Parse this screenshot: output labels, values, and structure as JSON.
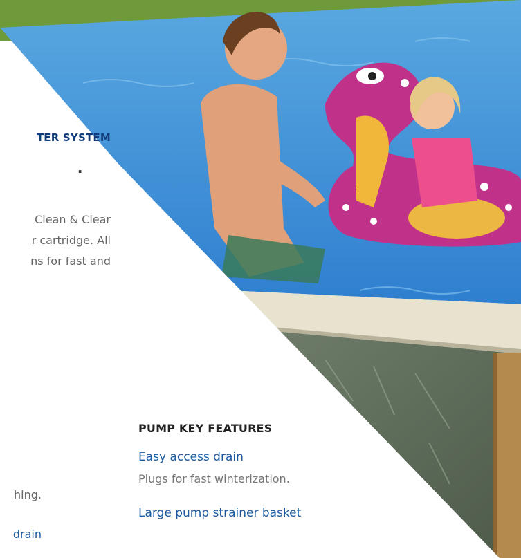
{
  "left_column": {
    "eyebrow": "TER SYSTEM",
    "title_fragment": ".",
    "body_lines": [
      "Clean & Clear",
      "r cartridge. All",
      "ns for fast and"
    ],
    "fragment_gray": "hing.",
    "fragment_blue": "drain"
  },
  "pump_features": {
    "heading": "PUMP KEY FEATURES",
    "items": [
      {
        "title": "Easy access drain",
        "description": "Plugs for fast winterization."
      },
      {
        "title": "Large pump strainer basket",
        "description": ""
      }
    ]
  },
  "colors": {
    "accent_blue": "#1a5aa0",
    "eyebrow_blue": "#123d7a",
    "body_gray": "#666666"
  }
}
